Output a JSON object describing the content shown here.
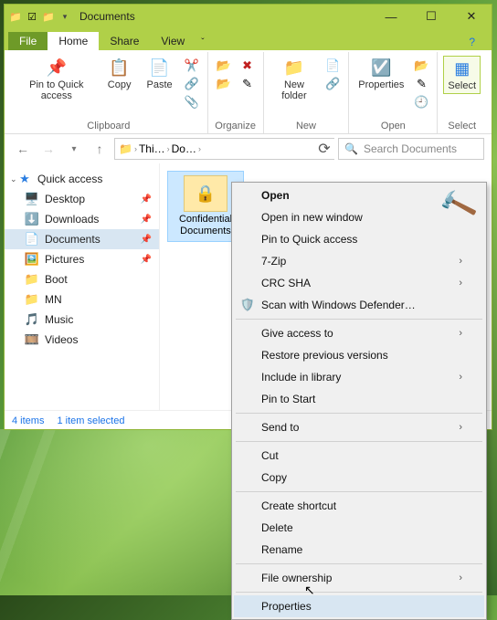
{
  "title": "Documents",
  "tabs": {
    "file": "File",
    "home": "Home",
    "share": "Share",
    "view": "View"
  },
  "ribbon": {
    "clipboard": {
      "label": "Clipboard",
      "pin": "Pin to Quick access",
      "copy": "Copy",
      "paste": "Paste"
    },
    "organize": {
      "label": "Organize"
    },
    "new": {
      "label": "New",
      "newfolder": "New folder"
    },
    "open": {
      "label": "Open",
      "properties": "Properties"
    },
    "select": {
      "label": "Select",
      "select": "Select"
    }
  },
  "path": {
    "seg1": "Thi…",
    "seg2": "Do…"
  },
  "search": {
    "placeholder": "Search Documents"
  },
  "sidebar": {
    "quick": "Quick access",
    "items": [
      {
        "icon": "🖥️",
        "label": "Desktop",
        "pin": true
      },
      {
        "icon": "⬇️",
        "label": "Downloads",
        "pin": true
      },
      {
        "icon": "📄",
        "label": "Documents",
        "pin": true,
        "sel": true
      },
      {
        "icon": "🖼️",
        "label": "Pictures",
        "pin": true
      },
      {
        "icon": "📁",
        "label": "Boot",
        "pin": false
      },
      {
        "icon": "📁",
        "label": "MN",
        "pin": false
      },
      {
        "icon": "🎵",
        "label": "Music",
        "pin": false
      },
      {
        "icon": "🎞️",
        "label": "Videos",
        "pin": false
      }
    ]
  },
  "file": {
    "name": "Confidential Documents"
  },
  "status": {
    "count": "4 items",
    "sel": "1 item selected"
  },
  "ctx": {
    "open": "Open",
    "opennew": "Open in new window",
    "pin": "Pin to Quick access",
    "zip": "7-Zip",
    "crc": "CRC SHA",
    "defender": "Scan with Windows Defender…",
    "give": "Give access to",
    "restore": "Restore previous versions",
    "include": "Include in library",
    "pinstart": "Pin to Start",
    "sendto": "Send to",
    "cut": "Cut",
    "copy": "Copy",
    "shortcut": "Create shortcut",
    "delete": "Delete",
    "rename": "Rename",
    "ownership": "File ownership",
    "properties": "Properties"
  }
}
